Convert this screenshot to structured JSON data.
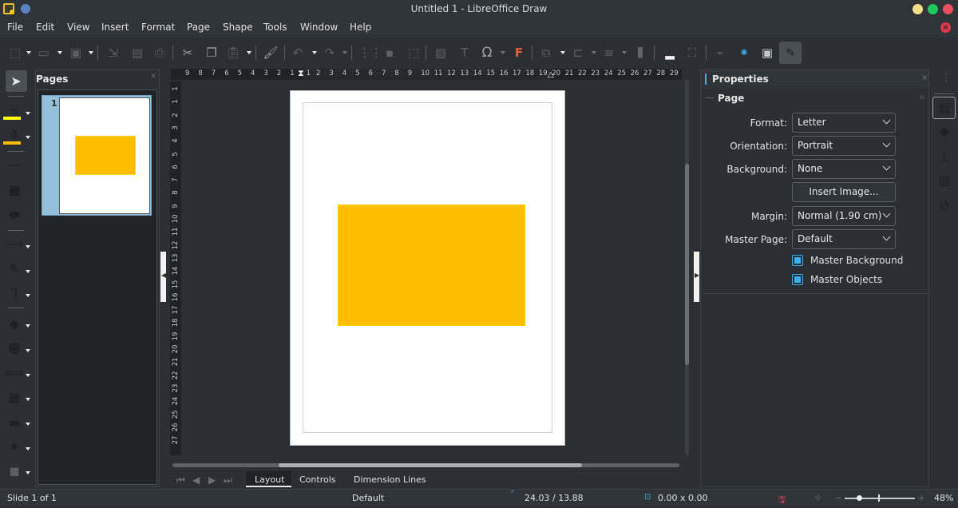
{
  "window": {
    "title": "Untitled 1 - LibreOffice Draw",
    "controls": {
      "minimize_color": "#f4e08a",
      "maximize_color": "#1fc95e",
      "close_color": "#ea4f5e"
    }
  },
  "menu": [
    "File",
    "Edit",
    "View",
    "Insert",
    "Format",
    "Page",
    "Shape",
    "Tools",
    "Window",
    "Help"
  ],
  "toolbar": {
    "icons": [
      "transformations-icon",
      "open-icon",
      "save-icon",
      "export-icon",
      "export-pdf-icon",
      "print-icon",
      "cut-icon",
      "copy-icon",
      "paste-icon",
      "clone-formatting-icon",
      "undo-icon",
      "redo-icon",
      "grid-icon",
      "helplines-icon",
      "crop-icon",
      "insert-image-icon",
      "insert-textbox-icon",
      "special-character-icon",
      "fontwork-icon",
      "arrange-icon",
      "align-icon",
      "distribute-icon",
      "select-to-distribute-icon",
      "shadow-icon",
      "crop-image-icon",
      "toggle-extrusion-icon",
      "connector-points-icon",
      "3d-object-icon",
      "drawing-functions-icon"
    ]
  },
  "left_tools": {
    "line_color": "#ffff00",
    "fill_color": "#ffbf00"
  },
  "pages_panel": {
    "title": "Pages",
    "close": "×",
    "thumbnails": [
      {
        "number": "1"
      }
    ]
  },
  "ruler": {
    "horizontal": [
      "9",
      "8",
      "7",
      "6",
      "5",
      "4",
      "3",
      "2",
      "1",
      "1",
      "2",
      "3",
      "4",
      "5",
      "6",
      "7",
      "8",
      "9",
      "10",
      "11",
      "12",
      "13",
      "14",
      "15",
      "16",
      "17",
      "18",
      "19",
      "20",
      "21",
      "22",
      "23",
      "24",
      "25",
      "26",
      "27",
      "28",
      "29"
    ],
    "vertical": [
      "1",
      "1",
      "2",
      "3",
      "4",
      "5",
      "6",
      "7",
      "8",
      "9",
      "10",
      "11",
      "12",
      "13",
      "14",
      "15",
      "16",
      "17",
      "18",
      "19",
      "20",
      "21",
      "22",
      "23",
      "24",
      "25",
      "26",
      "27"
    ]
  },
  "canvas": {
    "shape_fill": "#ffbf00"
  },
  "layer_tabs": {
    "tabs": [
      "Layout",
      "Controls",
      "Dimension Lines"
    ],
    "active": "Layout"
  },
  "properties": {
    "title": "Properties",
    "close": "×",
    "section": "Page",
    "fields": {
      "format": {
        "label": "Format:",
        "value": "Letter"
      },
      "orientation": {
        "label": "Orientation:",
        "value": "Portrait"
      },
      "background": {
        "label": "Background:",
        "value": "None"
      },
      "insert_image": "Insert Image...",
      "margin": {
        "label": "Margin:",
        "value": "Normal (1.90 cm)"
      },
      "master_page": {
        "label": "Master Page:",
        "value": "Default"
      }
    },
    "checkboxes": [
      {
        "label": "Master Background",
        "checked": true
      },
      {
        "label": "Master Objects",
        "checked": true
      }
    ]
  },
  "deck": [
    "properties-icon",
    "styles-icon",
    "gallery-icon",
    "navigator-icon",
    "shapes-icon"
  ],
  "status": {
    "slide": "Slide 1 of 1",
    "master": "Default",
    "position": "24.03 / 13.88",
    "size": "0.00 x 0.00",
    "zoom": "48%",
    "zoom_minus": "−",
    "zoom_plus": "+"
  }
}
